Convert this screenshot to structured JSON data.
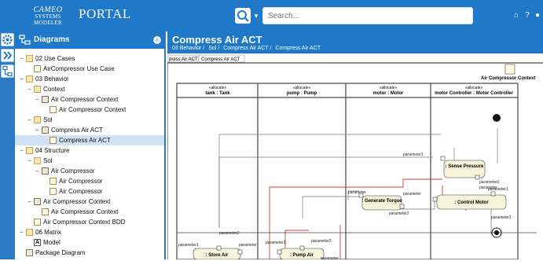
{
  "header": {
    "logo_brand": "CAMEO",
    "logo_sub": "SYSTEMS MODELER",
    "portal_title": "PORTAL",
    "search_placeholder": "Search...",
    "icons": [
      "home-icon",
      "help-icon",
      "user-icon"
    ]
  },
  "toolbar": {
    "buttons": [
      "gear-icon",
      "double-chevron-icon",
      "tree-icon"
    ]
  },
  "sidebar": {
    "title": "Diagrams",
    "items": [
      {
        "label": "02 Use Cases",
        "icon": "folder"
      },
      {
        "label": "AirCompressor Use Case",
        "icon": "diagram"
      },
      {
        "label": "03 Behavior",
        "icon": "folder"
      },
      {
        "label": "Context",
        "icon": "folder"
      },
      {
        "label": "Air Compressor Context",
        "icon": "block"
      },
      {
        "label": "Air Compressor Context",
        "icon": "diagram"
      },
      {
        "label": "Sol",
        "icon": "folder"
      },
      {
        "label": "Compress Air ACT",
        "icon": "activity"
      },
      {
        "label": "Compress Air ACT",
        "icon": "diagram"
      },
      {
        "label": "04 Structure",
        "icon": "folder"
      },
      {
        "label": "Sol",
        "icon": "folder"
      },
      {
        "label": "Air Compressor",
        "icon": "block"
      },
      {
        "label": "Air Compressor",
        "icon": "diagram"
      },
      {
        "label": "Air Compressor",
        "icon": "diagram"
      },
      {
        "label": "Air Compressor Context",
        "icon": "block"
      },
      {
        "label": "Air Compressor Context",
        "icon": "diagram"
      },
      {
        "label": "Air Compressor Context BDD",
        "icon": "diagram"
      },
      {
        "label": "06 Matrix",
        "icon": "folder"
      },
      {
        "label": "Model",
        "icon": "matrix"
      },
      {
        "label": "Package Diagram",
        "icon": "diagram"
      }
    ]
  },
  "main": {
    "title": "Compress Air ACT",
    "breadcrumbs": [
      "03 Behavior /",
      "Sol /",
      "Compress Air ACT /",
      "Compress Air ACT"
    ]
  },
  "diagram": {
    "tabs": [
      "press Air ACT",
      "Compress Air ACT"
    ],
    "context_label": "Air Compressor Context",
    "partitions": [
      {
        "stereotype": "«allocate»",
        "name": "tank : Tank"
      },
      {
        "stereotype": "«allocate»",
        "name": "pump : Pump"
      },
      {
        "stereotype": "«allocate»",
        "name": "motor : Motor"
      },
      {
        "stereotype": "«allocate»",
        "name": "motor Controller : Motor Controller"
      }
    ],
    "actions": [
      ": Sense Pressure",
      ": Generate Torque",
      ": Control Motor",
      ": Store Air",
      ": Pump Air"
    ],
    "param_label": "parameter",
    "param1": "parameter1",
    "param2": "parameter2"
  }
}
